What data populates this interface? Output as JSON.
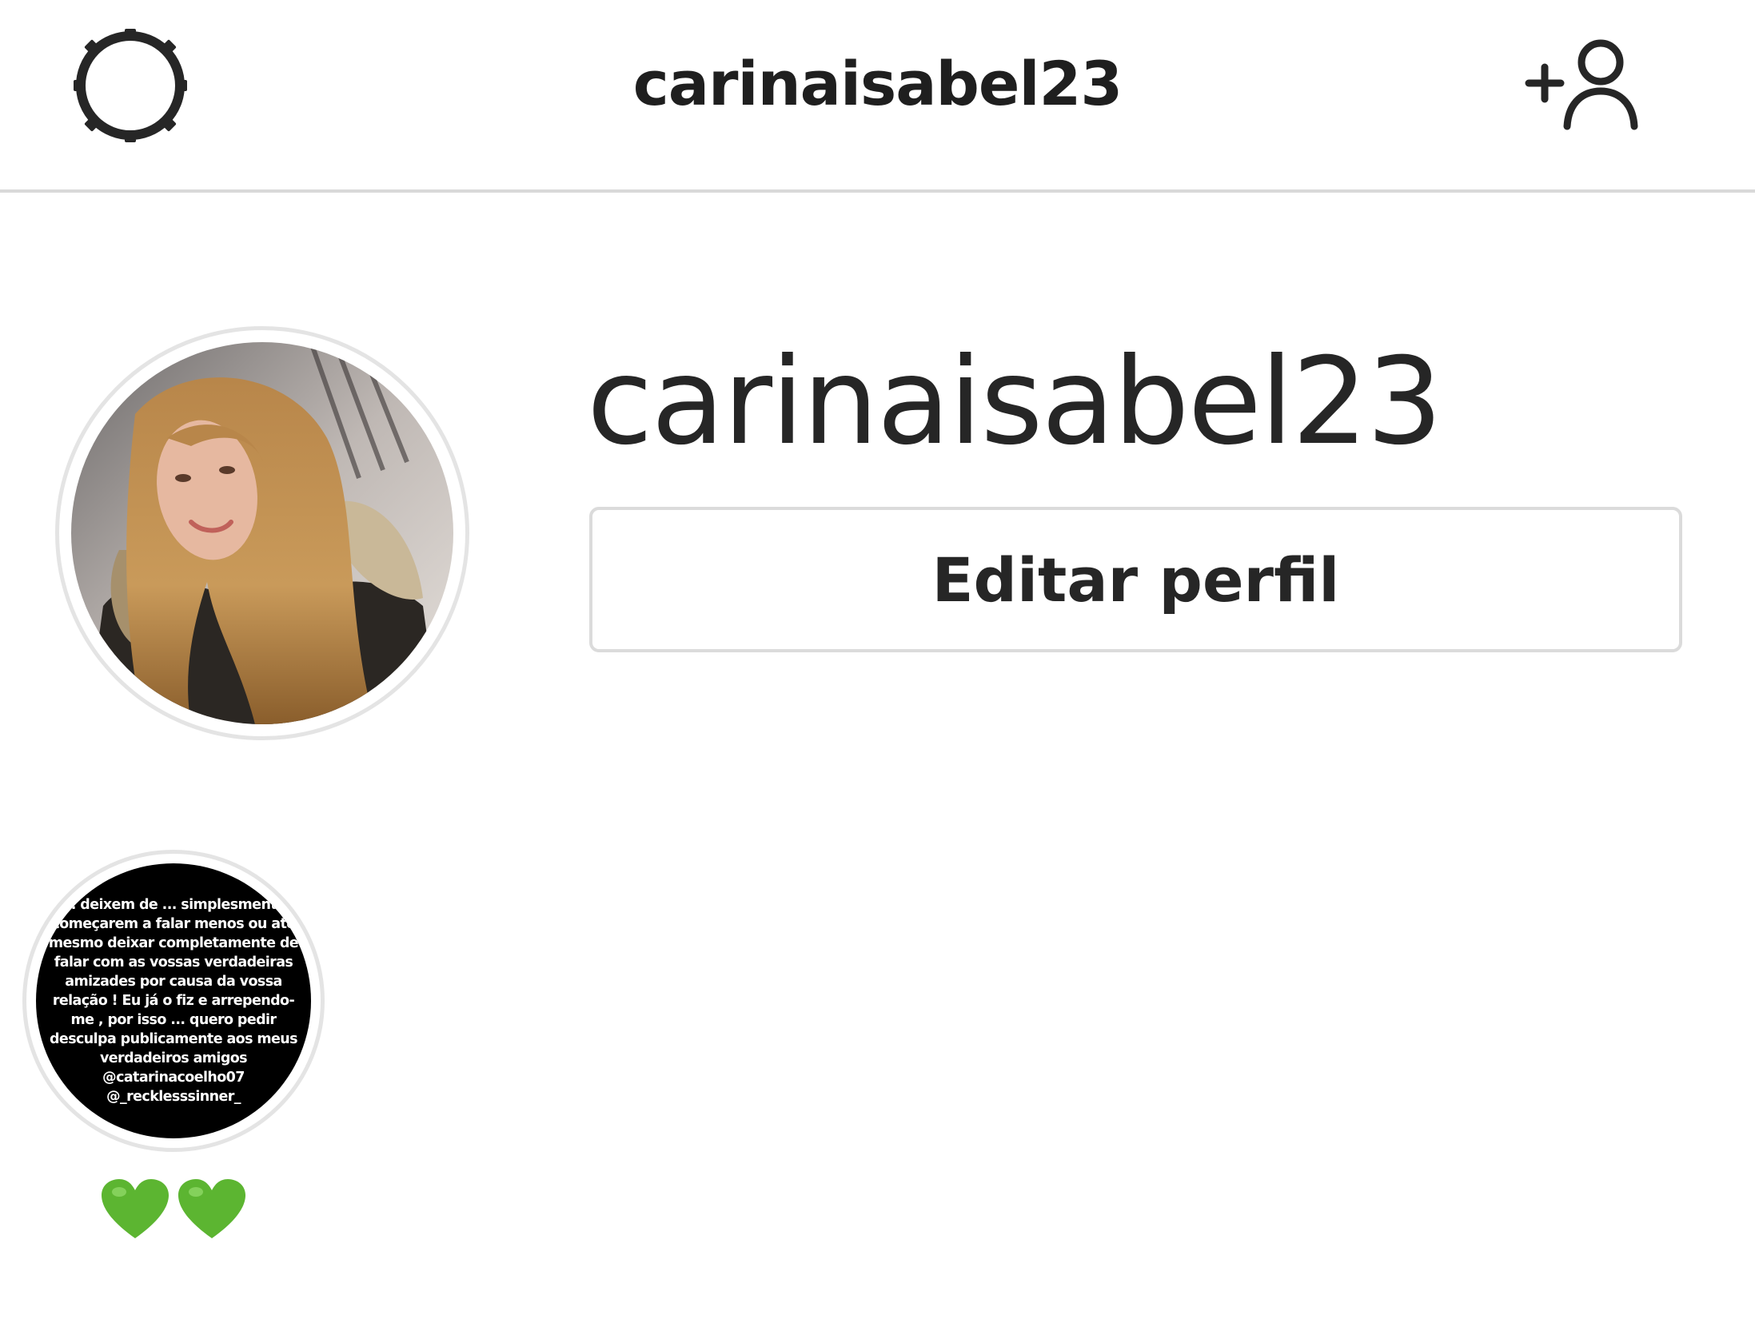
{
  "header": {
    "title": "carinaisabel23",
    "settings_icon": "settings-gear-icon",
    "add_user_icon": "add-person-icon"
  },
  "profile": {
    "username": "carinaisabel23",
    "edit_button_label": "Editar perfil"
  },
  "highlights": [
    {
      "cover_text": "... deixem de ... simplesmente começarem a falar menos ou até mesmo deixar completamente de falar com as vossas verdadeiras amizades por causa da vossa relação ! Eu já o fiz e arrependo-me , por isso ... quero pedir desculpa publicamente aos meus verdadeiros amigos @catarinacoelho07 @_recklesssinner_",
      "label": "💚💚",
      "label_color": "#5cb531"
    }
  ],
  "colors": {
    "text": "#262626",
    "divider": "#d9d9d9",
    "button_border": "#dbdbdb"
  }
}
